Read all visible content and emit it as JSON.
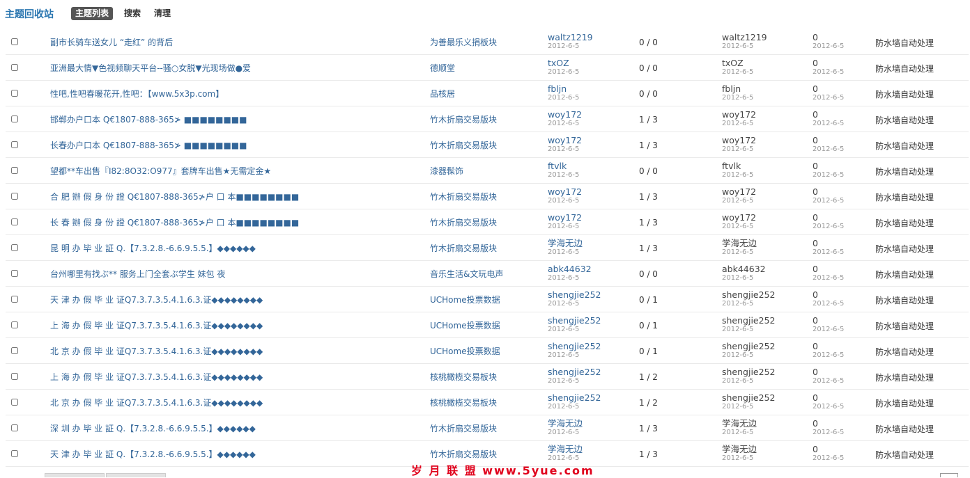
{
  "app_title": "主题回收站",
  "nav": [
    "主题列表",
    "搜索",
    "清理"
  ],
  "rows": [
    {
      "subject": "副市长骑车送女儿 “走红” 的背后",
      "forum": "为善最乐义捐板块",
      "author": "waltz1219",
      "author_date": "2012-6-5",
      "replies": "0 / 0",
      "last_poster": "waltz1219",
      "last_date": "2012-6-5",
      "deleted": "0",
      "deleted_date": "2012-6-5",
      "reason": "防水墙自动处理"
    },
    {
      "subject": "亚洲最大情▼色视频聊天平台--骚○女脱▼光现场做●爱",
      "forum": "德顺堂",
      "author": "txOZ",
      "author_date": "2012-6-5",
      "replies": "0 / 0",
      "last_poster": "txOZ",
      "last_date": "2012-6-5",
      "deleted": "0",
      "deleted_date": "2012-6-5",
      "reason": "防水墙自动处理"
    },
    {
      "subject": "性吧,性吧春暖花开,性吧：【www.5x3p.com】",
      "forum": "品核居",
      "author": "fbljn",
      "author_date": "2012-6-5",
      "replies": "0 / 0",
      "last_poster": "fbljn",
      "last_date": "2012-6-5",
      "deleted": "0",
      "deleted_date": "2012-6-5",
      "reason": "防水墙自动处理"
    },
    {
      "subject": "邯郸办户口本 Q€1807-888-365≯ ■■■■■■■■",
      "forum": "竹木折扇交易版块",
      "author": "woy172",
      "author_date": "2012-6-5",
      "replies": "1 / 3",
      "last_poster": "woy172",
      "last_date": "2012-6-5",
      "deleted": "0",
      "deleted_date": "2012-6-5",
      "reason": "防水墙自动处理"
    },
    {
      "subject": "长春办户口本 Q€1807-888-365≯ ■■■■■■■■",
      "forum": "竹木折扇交易版块",
      "author": "woy172",
      "author_date": "2012-6-5",
      "replies": "1 / 3",
      "last_poster": "woy172",
      "last_date": "2012-6-5",
      "deleted": "0",
      "deleted_date": "2012-6-5",
      "reason": "防水墙自动处理"
    },
    {
      "subject": "望都**车出售『I82:8O32:O977』套牌车出售★无需定金★",
      "forum": "漆器髹饰",
      "author": "ftvlk",
      "author_date": "2012-6-5",
      "replies": "0 / 0",
      "last_poster": "ftvlk",
      "last_date": "2012-6-5",
      "deleted": "0",
      "deleted_date": "2012-6-5",
      "reason": "防水墙自动处理"
    },
    {
      "subject": "合 肥 辦 假 身 份 證 Q€1807-888-365≯户 口 本■■■■■■■■",
      "forum": "竹木折扇交易版块",
      "author": "woy172",
      "author_date": "2012-6-5",
      "replies": "1 / 3",
      "last_poster": "woy172",
      "last_date": "2012-6-5",
      "deleted": "0",
      "deleted_date": "2012-6-5",
      "reason": "防水墙自动处理"
    },
    {
      "subject": "长 春 辦 假 身 份 證 Q€1807-888-365≯户 口 本■■■■■■■■",
      "forum": "竹木折扇交易版块",
      "author": "woy172",
      "author_date": "2012-6-5",
      "replies": "1 / 3",
      "last_poster": "woy172",
      "last_date": "2012-6-5",
      "deleted": "0",
      "deleted_date": "2012-6-5",
      "reason": "防水墙自动处理"
    },
    {
      "subject": "昆 明 办 毕 业 証 Q.【7.3.2.8.-6.6.9.5.5.】◆◆◆◆◆◆",
      "forum": "竹木折扇交易版块",
      "author": "学海无边",
      "author_date": "2012-6-5",
      "replies": "1 / 3",
      "last_poster": "学海无边",
      "last_date": "2012-6-5",
      "deleted": "0",
      "deleted_date": "2012-6-5",
      "reason": "防水墙自动处理"
    },
    {
      "subject": "台州哪里有找ぶ** 服务上门全套ぶ学生 妹包 夜",
      "forum": "音乐生活&文玩电声",
      "author": "abk44632",
      "author_date": "2012-6-5",
      "replies": "0 / 0",
      "last_poster": "abk44632",
      "last_date": "2012-6-5",
      "deleted": "0",
      "deleted_date": "2012-6-5",
      "reason": "防水墙自动处理"
    },
    {
      "subject": "天 津 办 假 毕 业 证Q7.3.7.3.5.4.1.6.3.证◆◆◆◆◆◆◆◆",
      "forum": "UCHome投票数据",
      "author": "shengjie252",
      "author_date": "2012-6-5",
      "replies": "0 / 1",
      "last_poster": "shengjie252",
      "last_date": "2012-6-5",
      "deleted": "0",
      "deleted_date": "2012-6-5",
      "reason": "防水墙自动处理"
    },
    {
      "subject": "上 海 办 假 毕 业 证Q7.3.7.3.5.4.1.6.3.证◆◆◆◆◆◆◆◆",
      "forum": "UCHome投票数据",
      "author": "shengjie252",
      "author_date": "2012-6-5",
      "replies": "0 / 1",
      "last_poster": "shengjie252",
      "last_date": "2012-6-5",
      "deleted": "0",
      "deleted_date": "2012-6-5",
      "reason": "防水墙自动处理"
    },
    {
      "subject": "北 京 办 假 毕 业 证Q7.3.7.3.5.4.1.6.3.证◆◆◆◆◆◆◆◆",
      "forum": "UCHome投票数据",
      "author": "shengjie252",
      "author_date": "2012-6-5",
      "replies": "0 / 1",
      "last_poster": "shengjie252",
      "last_date": "2012-6-5",
      "deleted": "0",
      "deleted_date": "2012-6-5",
      "reason": "防水墙自动处理"
    },
    {
      "subject": "上 海 办 假 毕 业 证Q7.3.7.3.5.4.1.6.3.证◆◆◆◆◆◆◆◆",
      "forum": "核桃橄榄交易板块",
      "author": "shengjie252",
      "author_date": "2012-6-5",
      "replies": "1 / 2",
      "last_poster": "shengjie252",
      "last_date": "2012-6-5",
      "deleted": "0",
      "deleted_date": "2012-6-5",
      "reason": "防水墙自动处理"
    },
    {
      "subject": "北 京 办 假 毕 业 证Q7.3.7.3.5.4.1.6.3.证◆◆◆◆◆◆◆◆",
      "forum": "核桃橄榄交易板块",
      "author": "shengjie252",
      "author_date": "2012-6-5",
      "replies": "1 / 2",
      "last_poster": "shengjie252",
      "last_date": "2012-6-5",
      "deleted": "0",
      "deleted_date": "2012-6-5",
      "reason": "防水墙自动处理"
    },
    {
      "subject": "深 圳 办 毕 业 証 Q.【7.3.2.8.-6.6.9.5.5.】◆◆◆◆◆◆",
      "forum": "竹木折扇交易版块",
      "author": "学海无边",
      "author_date": "2012-6-5",
      "replies": "1 / 3",
      "last_poster": "学海无边",
      "last_date": "2012-6-5",
      "deleted": "0",
      "deleted_date": "2012-6-5",
      "reason": "防水墙自动处理"
    },
    {
      "subject": "天 津 办 毕 业 証 Q.【7.3.2.8.-6.6.9.5.5.】◆◆◆◆◆◆",
      "forum": "竹木折扇交易版块",
      "author": "学海无边",
      "author_date": "2012-6-5",
      "replies": "1 / 3",
      "last_poster": "学海无边",
      "last_date": "2012-6-5",
      "deleted": "0",
      "deleted_date": "2012-6-5",
      "reason": "防水墙自动处理"
    }
  ],
  "watermark": "岁 月 联 盟   www.5yue.com",
  "colors": {
    "link": "#336699",
    "title": "#2a76b0",
    "active_tab_bg": "#555555",
    "watermark": "#e0001b"
  }
}
